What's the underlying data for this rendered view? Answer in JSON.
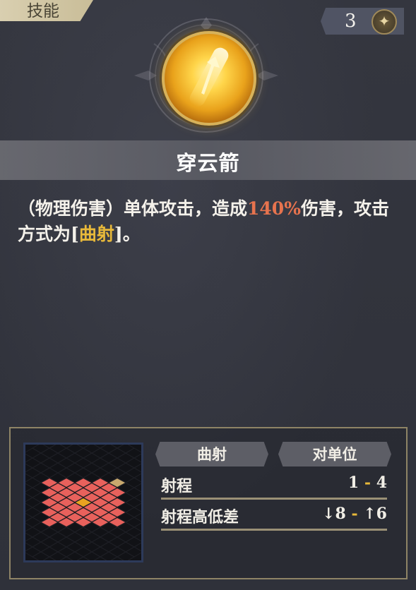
{
  "header": {
    "tab_label": "技能"
  },
  "currency": {
    "count": "3",
    "icon": "star-coin-icon"
  },
  "skill": {
    "name": "穿云箭",
    "icon": "golden-arrow-medal-icon",
    "desc_part1": "（物理伤害）单体攻击，造成",
    "desc_percent": "140%",
    "desc_part2": "伤害，攻击方式为",
    "desc_bracket_open": "[",
    "desc_attack_type": "曲射",
    "desc_bracket_close": "]",
    "desc_end": "。"
  },
  "info": {
    "attack_type_btn": "曲射",
    "target_btn": "对单位",
    "range_label": "射程",
    "range_min": "1",
    "range_sep": "-",
    "range_max": "4",
    "height_label": "射程高低差",
    "height_down": "↓8",
    "height_sep": "-",
    "height_up": "↑6"
  },
  "colors": {
    "damage_percent": "#e6734e",
    "keyword": "#e8b93a",
    "range_tile": "#e8615c",
    "center_tile": "#e8a321",
    "target_tile": "#c9a96e"
  }
}
